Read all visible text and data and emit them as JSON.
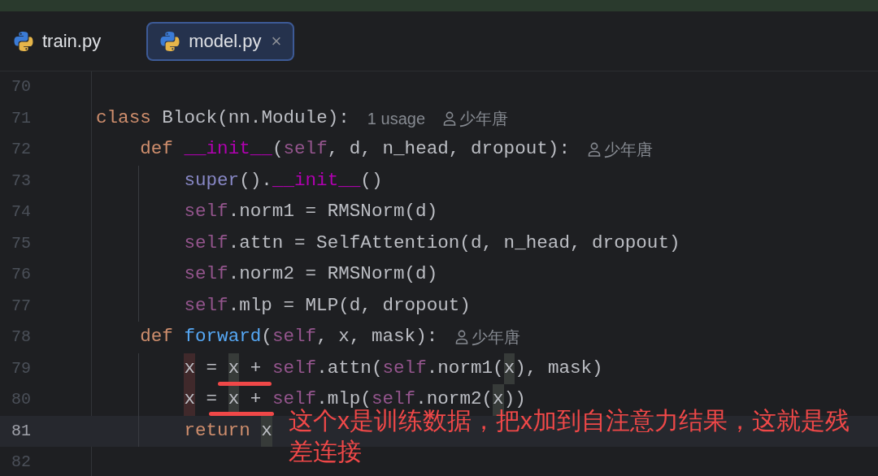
{
  "tabs": [
    {
      "label": "train.py",
      "selected": false
    },
    {
      "label": "model.py",
      "selected": true,
      "close": "×"
    }
  ],
  "editor": {
    "lines": [
      {
        "number": "70",
        "current": false
      },
      {
        "number": "71",
        "current": false,
        "tokens": [
          {
            "text": "class ",
            "kind": "keyword"
          },
          {
            "text": "Block(nn.Module):",
            "kind": "plain"
          }
        ],
        "hints": [
          {
            "kind": "usage",
            "text": "1 usage"
          },
          {
            "kind": "author",
            "text": "少年唐"
          }
        ],
        "children": [
          {
            "number": "72",
            "current": false,
            "tokens": [
              {
                "text": "def ",
                "kind": "keyword"
              },
              {
                "text": "__init__",
                "kind": "magic"
              },
              {
                "text": "(",
                "kind": "plain"
              },
              {
                "text": "self",
                "kind": "self"
              },
              {
                "text": ", d, n_head, dropout):",
                "kind": "plain"
              }
            ],
            "hints": [
              {
                "kind": "author",
                "text": "少年唐"
              }
            ],
            "children": [
              {
                "number": "73",
                "current": false,
                "tokens": [
                  {
                    "text": "super",
                    "kind": "builtin"
                  },
                  {
                    "text": "().",
                    "kind": "plain"
                  },
                  {
                    "text": "__init__",
                    "kind": "magic"
                  },
                  {
                    "text": "()",
                    "kind": "plain"
                  }
                ]
              },
              {
                "number": "74",
                "current": false,
                "tokens": [
                  {
                    "text": "self",
                    "kind": "self"
                  },
                  {
                    "text": ".norm1 = RMSNorm(d)",
                    "kind": "plain"
                  }
                ]
              },
              {
                "number": "75",
                "current": false,
                "tokens": [
                  {
                    "text": "self",
                    "kind": "self"
                  },
                  {
                    "text": ".attn = SelfAttention(d, n_head, dropout)",
                    "kind": "plain"
                  }
                ]
              },
              {
                "number": "76",
                "current": false,
                "tokens": [
                  {
                    "text": "self",
                    "kind": "self"
                  },
                  {
                    "text": ".norm2 = RMSNorm(d)",
                    "kind": "plain"
                  }
                ]
              },
              {
                "number": "77",
                "current": false,
                "tokens": [
                  {
                    "text": "self",
                    "kind": "self"
                  },
                  {
                    "text": ".mlp = MLP(d, dropout)",
                    "kind": "plain"
                  }
                ]
              }
            ]
          },
          {
            "number": "78",
            "current": false,
            "tokens": [
              {
                "text": "def ",
                "kind": "keyword"
              },
              {
                "text": "forward",
                "kind": "function"
              },
              {
                "text": "(",
                "kind": "plain"
              },
              {
                "text": "self",
                "kind": "self"
              },
              {
                "text": ", x, mask):",
                "kind": "plain"
              }
            ],
            "hints": [
              {
                "kind": "author",
                "text": "少年唐"
              }
            ],
            "children": [
              {
                "number": "79",
                "current": false,
                "tokens": [
                  {
                    "text": "x",
                    "kind": "write_usage"
                  },
                  {
                    "text": " = ",
                    "kind": "plain"
                  },
                  {
                    "text": "x",
                    "kind": "read_usage"
                  },
                  {
                    "text": " + ",
                    "kind": "plain"
                  },
                  {
                    "text": "self",
                    "kind": "self"
                  },
                  {
                    "text": ".attn(",
                    "kind": "plain"
                  },
                  {
                    "text": "self",
                    "kind": "self"
                  },
                  {
                    "text": ".norm1(",
                    "kind": "plain"
                  },
                  {
                    "text": "x",
                    "kind": "read_usage"
                  },
                  {
                    "text": "), mask)",
                    "kind": "plain"
                  }
                ]
              },
              {
                "number": "80",
                "current": false,
                "tokens": [
                  {
                    "text": "x",
                    "kind": "write_usage"
                  },
                  {
                    "text": " = ",
                    "kind": "plain"
                  },
                  {
                    "text": "x",
                    "kind": "read_usage"
                  },
                  {
                    "text": " + ",
                    "kind": "plain"
                  },
                  {
                    "text": "self",
                    "kind": "self"
                  },
                  {
                    "text": ".mlp(",
                    "kind": "plain"
                  },
                  {
                    "text": "self",
                    "kind": "self"
                  },
                  {
                    "text": ".norm2(",
                    "kind": "plain"
                  },
                  {
                    "text": "x",
                    "kind": "read_usage"
                  },
                  {
                    "text": "))",
                    "kind": "plain"
                  }
                ]
              },
              {
                "number": "81",
                "current": true,
                "tokens": [
                  {
                    "text": "return ",
                    "kind": "keyword"
                  },
                  {
                    "text": "x",
                    "kind": "read_usage"
                  }
                ]
              }
            ]
          }
        ]
      },
      {
        "number": "82",
        "current": false
      }
    ]
  },
  "annotation": {
    "text": "这个x是训练数据，把x加到自注意力结果，这就是残差连接",
    "color": "#f04848"
  }
}
